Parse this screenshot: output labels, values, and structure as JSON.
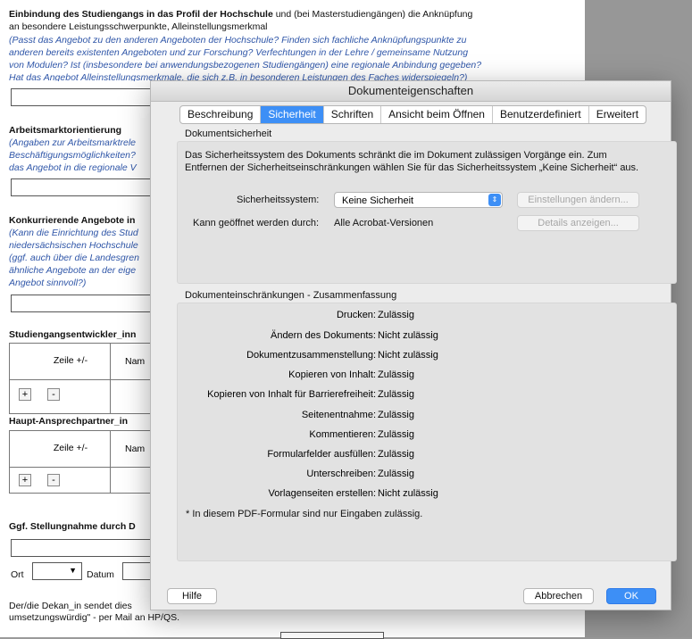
{
  "form": {
    "s1_bold": "Einbindung des Studiengangs in das Profil der Hochschule",
    "s1_rest": " und (bei Masterstudiengängen) die Anknüpfung",
    "s1_line2": "an besondere Leistungsschwerpunkte, Alleinstellungsmerkmal",
    "s1_blue1": "(Passt das Angebot zu den anderen Angeboten der Hochschule? Finden sich fachliche Anknüpfungspunkte zu",
    "s1_blue2": "anderen bereits existenten Angeboten und zur Forschung? Verfechtungen in der Lehre / gemeinsame Nutzung",
    "s1_blue3": "von Modulen? Ist (insbesondere bei anwendungsbezogenen Studiengängen) eine regionale Anbindung gegeben?",
    "s1_blue4": "Hat das Angebot Alleinstellungsmerkmale, die sich z.B. in besonderen Leistungen des Faches widerspiegeln?)",
    "s2_title": "Arbeitsmarktorientierung",
    "s2_blue1": "(Angaben zur Arbeitsmarktrele",
    "s2_blue2": "Beschäftigungsmöglichkeiten?",
    "s2_blue3": "das Angebot in die regionale V",
    "s3_title": "Konkurrierende Angebote in",
    "s3_blue1": "(Kann die Einrichtung des Stud",
    "s3_blue2": "niedersächsischen Hochschule",
    "s3_blue3": "(ggf. auch über die Landesgren",
    "s3_blue4": "ähnliche Angebote an der eige",
    "s3_blue5": "Angebot sinnvoll?)",
    "s4_title": "Studiengangsentwickler_inn",
    "s5_title": "Haupt-Ansprechpartner_in",
    "col_zeile": "Zeile +/-",
    "col_name": "Nam",
    "plus": "+",
    "minus": "-",
    "s6_title": "Ggf. Stellungnahme durch D",
    "ort_label": "Ort",
    "datum_label": "Datum",
    "footer1": "Der/die  Dekan_in sendet dies",
    "footer2": "umsetzungswürdig\" -  per Mail an HP/QS."
  },
  "dialog": {
    "title": "Dokumenteigenschaften",
    "tabs": [
      "Beschreibung",
      "Sicherheit",
      "Schriften",
      "Ansicht beim Öffnen",
      "Benutzerdefiniert",
      "Erweitert"
    ],
    "active_tab": "Sicherheit",
    "security_heading": "Dokumentsicherheit",
    "security_desc": "Das Sicherheitssystem des Dokuments schränkt die im Dokument zulässigen Vorgänge ein. Zum Entfernen der Sicherheitseinschränkungen wählen Sie für das Sicherheitssystem „Keine Sicherheit“ aus.",
    "system_label": "Sicherheitssystem:",
    "system_value": "Keine Sicherheit",
    "change_settings": "Einstellungen ändern...",
    "opened_by_label": "Kann geöffnet werden durch:",
    "opened_by_value": "Alle Acrobat-Versionen",
    "show_details": "Details anzeigen...",
    "summary_heading": "Dokumenteinschränkungen - Zusammenfassung",
    "summary": [
      {
        "k": "Drucken:",
        "v": "Zulässig"
      },
      {
        "k": "Ändern des Dokuments:",
        "v": "Nicht zulässig"
      },
      {
        "k": "Dokumentzusammenstellung:",
        "v": "Nicht zulässig"
      },
      {
        "k": "Kopieren von Inhalt:",
        "v": "Zulässig"
      },
      {
        "k": "Kopieren von Inhalt für Barrierefreiheit:",
        "v": "Zulässig"
      },
      {
        "k": "Seitenentnahme:",
        "v": "Zulässig"
      },
      {
        "k": "Kommentieren:",
        "v": "Zulässig"
      },
      {
        "k": "Formularfelder ausfüllen:",
        "v": "Zulässig"
      },
      {
        "k": "Unterschreiben:",
        "v": "Zulässig"
      },
      {
        "k": "Vorlagenseiten erstellen:",
        "v": "Nicht zulässig"
      }
    ],
    "note": "*  In diesem PDF-Formular sind nur Eingaben zulässig.",
    "help": "Hilfe",
    "cancel": "Abbrechen",
    "ok": "OK"
  }
}
